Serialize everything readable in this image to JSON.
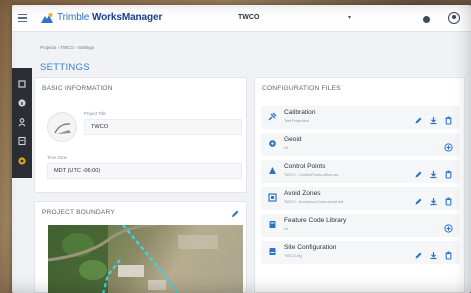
{
  "app": {
    "logo_text_light": "Trimble ",
    "logo_text_bold": "WorksManager",
    "project_name": "TWCO",
    "accent": "#3b7fcc",
    "brand_dark": "#163f8f"
  },
  "breadcrumb": "Projects › TWCO › Settings",
  "page_title": "SETTINGS",
  "rail": {
    "items": [
      "layers-icon",
      "info-icon",
      "users-icon",
      "files-icon",
      "settings-icon"
    ],
    "active_color": "#e6a21b"
  },
  "basic_info": {
    "title": "BASIC INFORMATION",
    "project_title_label": "Project Title",
    "project_title_value": "TWCO",
    "time_zone_label": "Time Zone",
    "time_zone_value": "MDT (UTC -06:00)"
  },
  "project_boundary": {
    "title": "PROJECT BOUNDARY"
  },
  "config_files": {
    "title": "CONFIGURATION FILES",
    "items": [
      {
        "name": "Calibration",
        "sub": "Test Projection",
        "icon": "satellite-icon",
        "actions": "edit-download-delete"
      },
      {
        "name": "Geoid",
        "sub": "n/f",
        "icon": "globe-icon",
        "actions": "add"
      },
      {
        "name": "Control Points",
        "sub": "TWCO - ControlPoints.office.csv",
        "icon": "triangle-icon",
        "actions": "edit-download-delete"
      },
      {
        "name": "Avoid Zones",
        "sub": "TWCO - AvoidanceZones.avoid.dxf",
        "icon": "zone-icon",
        "actions": "edit-download-delete"
      },
      {
        "name": "Feature Code Library",
        "sub": "n/f",
        "icon": "library-icon",
        "actions": "add"
      },
      {
        "name": "Site Configuration",
        "sub": "TWCO.cfg",
        "icon": "site-config-icon",
        "actions": "edit-download-delete"
      }
    ]
  }
}
